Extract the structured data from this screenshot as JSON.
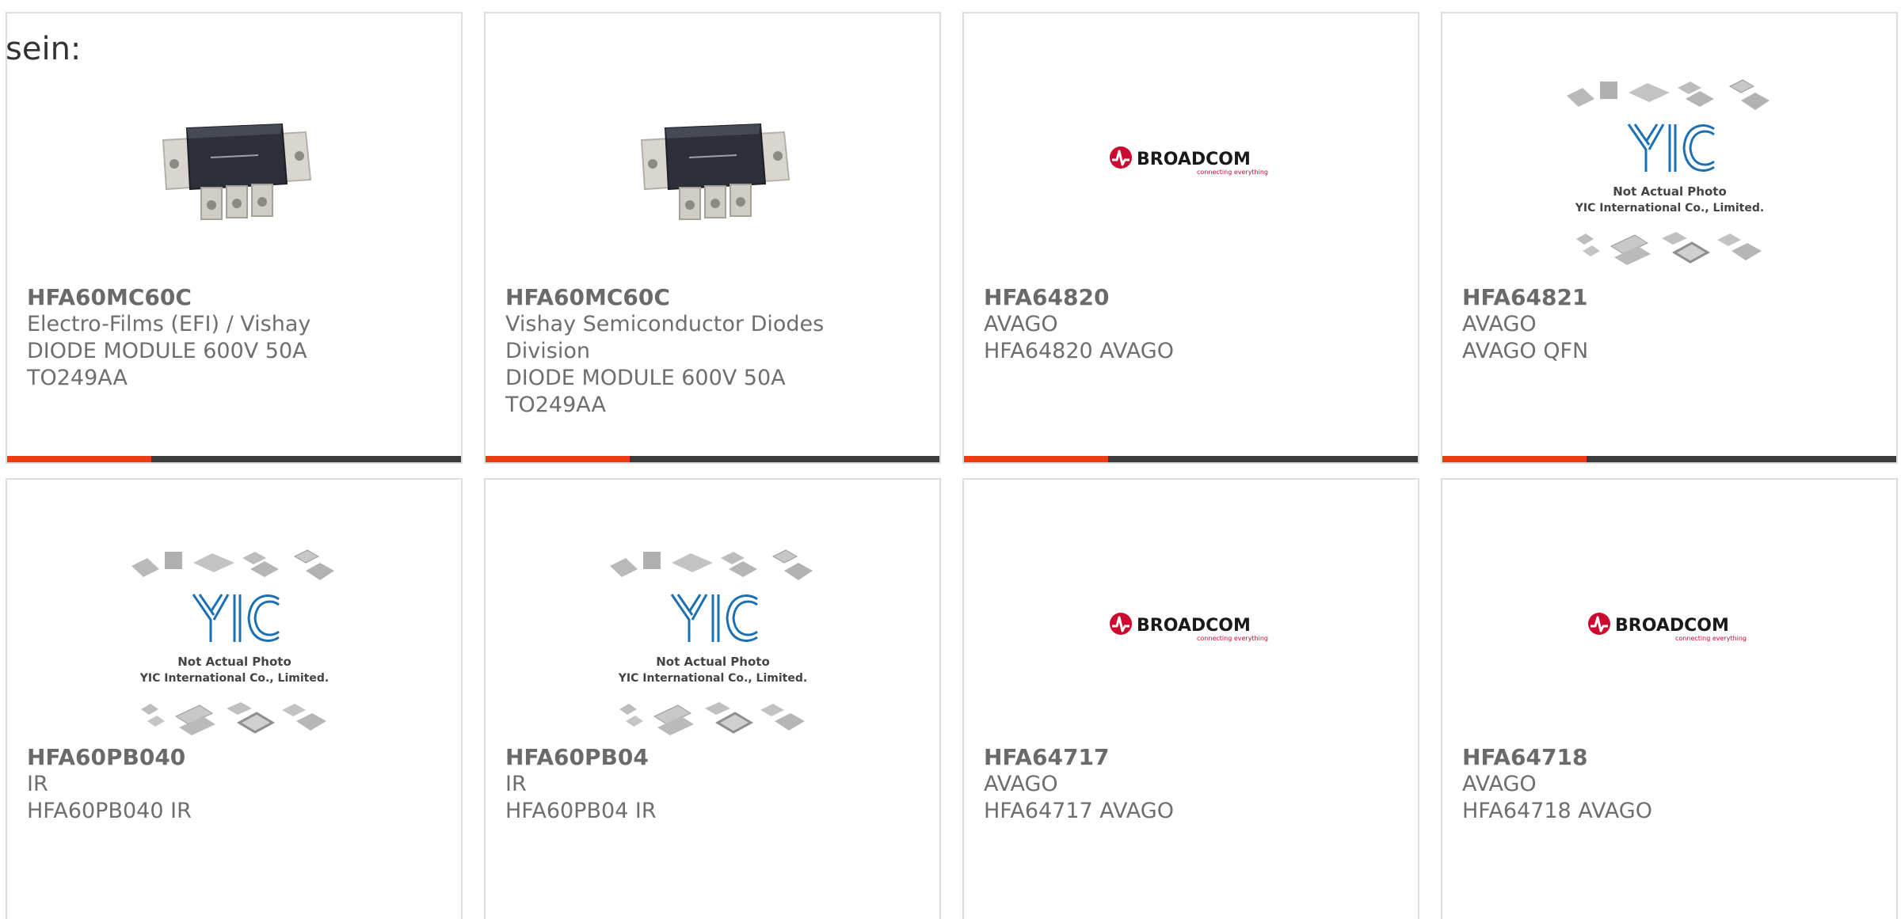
{
  "leading_text": "sein:",
  "colors": {
    "accent_bar": "#ec3b13",
    "dark_bar": "#3c3c3c",
    "card_border": "#dedede",
    "broadcom_red": "#cc092f",
    "yic_blue": "#1b6fb3"
  },
  "products": [
    {
      "part": "HFA60MC60C",
      "lines": [
        "Electro-Films (EFI) / Vishay",
        "DIODE MODULE 600V 50A",
        "TO249AA"
      ],
      "image_type": "diode-module-photo"
    },
    {
      "part": "HFA60MC60C",
      "lines": [
        "Vishay Semiconductor Diodes",
        "Division",
        "DIODE MODULE 600V 50A",
        "TO249AA"
      ],
      "image_type": "diode-module-photo"
    },
    {
      "part": "HFA64820",
      "lines": [
        "AVAGO",
        "HFA64820 AVAGO"
      ],
      "image_type": "broadcom-logo"
    },
    {
      "part": "HFA64821",
      "lines": [
        "AVAGO",
        "AVAGO QFN"
      ],
      "image_type": "yic-placeholder"
    },
    {
      "part": "HFA60PB040",
      "lines": [
        "IR",
        "HFA60PB040 IR"
      ],
      "image_type": "yic-placeholder"
    },
    {
      "part": "HFA60PB04",
      "lines": [
        "IR",
        "HFA60PB04 IR"
      ],
      "image_type": "yic-placeholder"
    },
    {
      "part": "HFA64717",
      "lines": [
        "AVAGO",
        "HFA64717 AVAGO"
      ],
      "image_type": "broadcom-logo"
    },
    {
      "part": "HFA64718",
      "lines": [
        "AVAGO",
        "HFA64718 AVAGO"
      ],
      "image_type": "broadcom-logo"
    }
  ],
  "broadcom_logo": {
    "wordmark": "BROADCOM",
    "tagline": "connecting everything"
  },
  "yic_placeholder": {
    "monogram": "YIC",
    "caption_line1": "Not Actual Photo",
    "caption_line2": "YIC International Co., Limited."
  }
}
